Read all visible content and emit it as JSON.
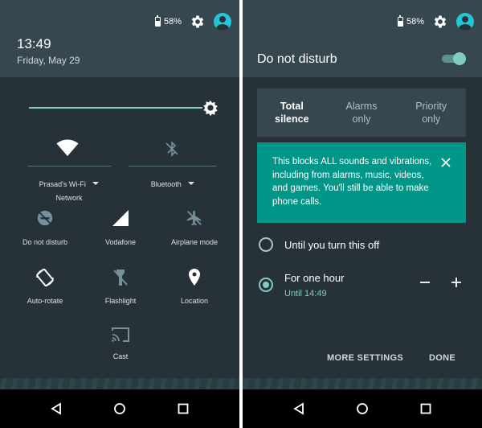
{
  "status": {
    "battery": "58%"
  },
  "shade": {
    "time": "13:49",
    "date": "Friday, May 29",
    "wifi": {
      "ssid": "Prasad's Wi-Fi",
      "sub": "Network"
    },
    "bluetooth": {
      "label": "Bluetooth"
    },
    "tiles": [
      {
        "label": "Do not disturb"
      },
      {
        "label": "Vodafone"
      },
      {
        "label": "Airplane mode"
      },
      {
        "label": "Auto-rotate"
      },
      {
        "label": "Flashlight"
      },
      {
        "label": "Location"
      },
      {
        "label": "Cast"
      }
    ]
  },
  "dnd": {
    "title": "Do not disturb",
    "modes": [
      {
        "line1": "Total",
        "line2": "silence"
      },
      {
        "line1": "Alarms",
        "line2": "only"
      },
      {
        "line1": "Priority",
        "line2": "only"
      }
    ],
    "info": "This blocks ALL sounds and vibrations, including from alarms, music, videos, and games. You'll still be able to make phone calls.",
    "option_until_off": "Until you turn this off",
    "option_hour": "For one hour",
    "option_hour_sub": "Until 14:49",
    "more_settings": "MORE SETTINGS",
    "done": "DONE"
  },
  "colors": {
    "accent": "#80cbc4",
    "banner": "#009688",
    "header": "#37474f",
    "panel": "#263238"
  },
  "icons": [
    "battery-icon",
    "gear-icon",
    "avatar-icon",
    "wifi-icon",
    "bluetooth-icon",
    "dnd-icon",
    "signal-icon",
    "airplane-icon",
    "rotate-icon",
    "flashlight-icon",
    "location-icon",
    "cast-icon",
    "close-icon",
    "back-icon",
    "home-icon",
    "recents-icon"
  ]
}
